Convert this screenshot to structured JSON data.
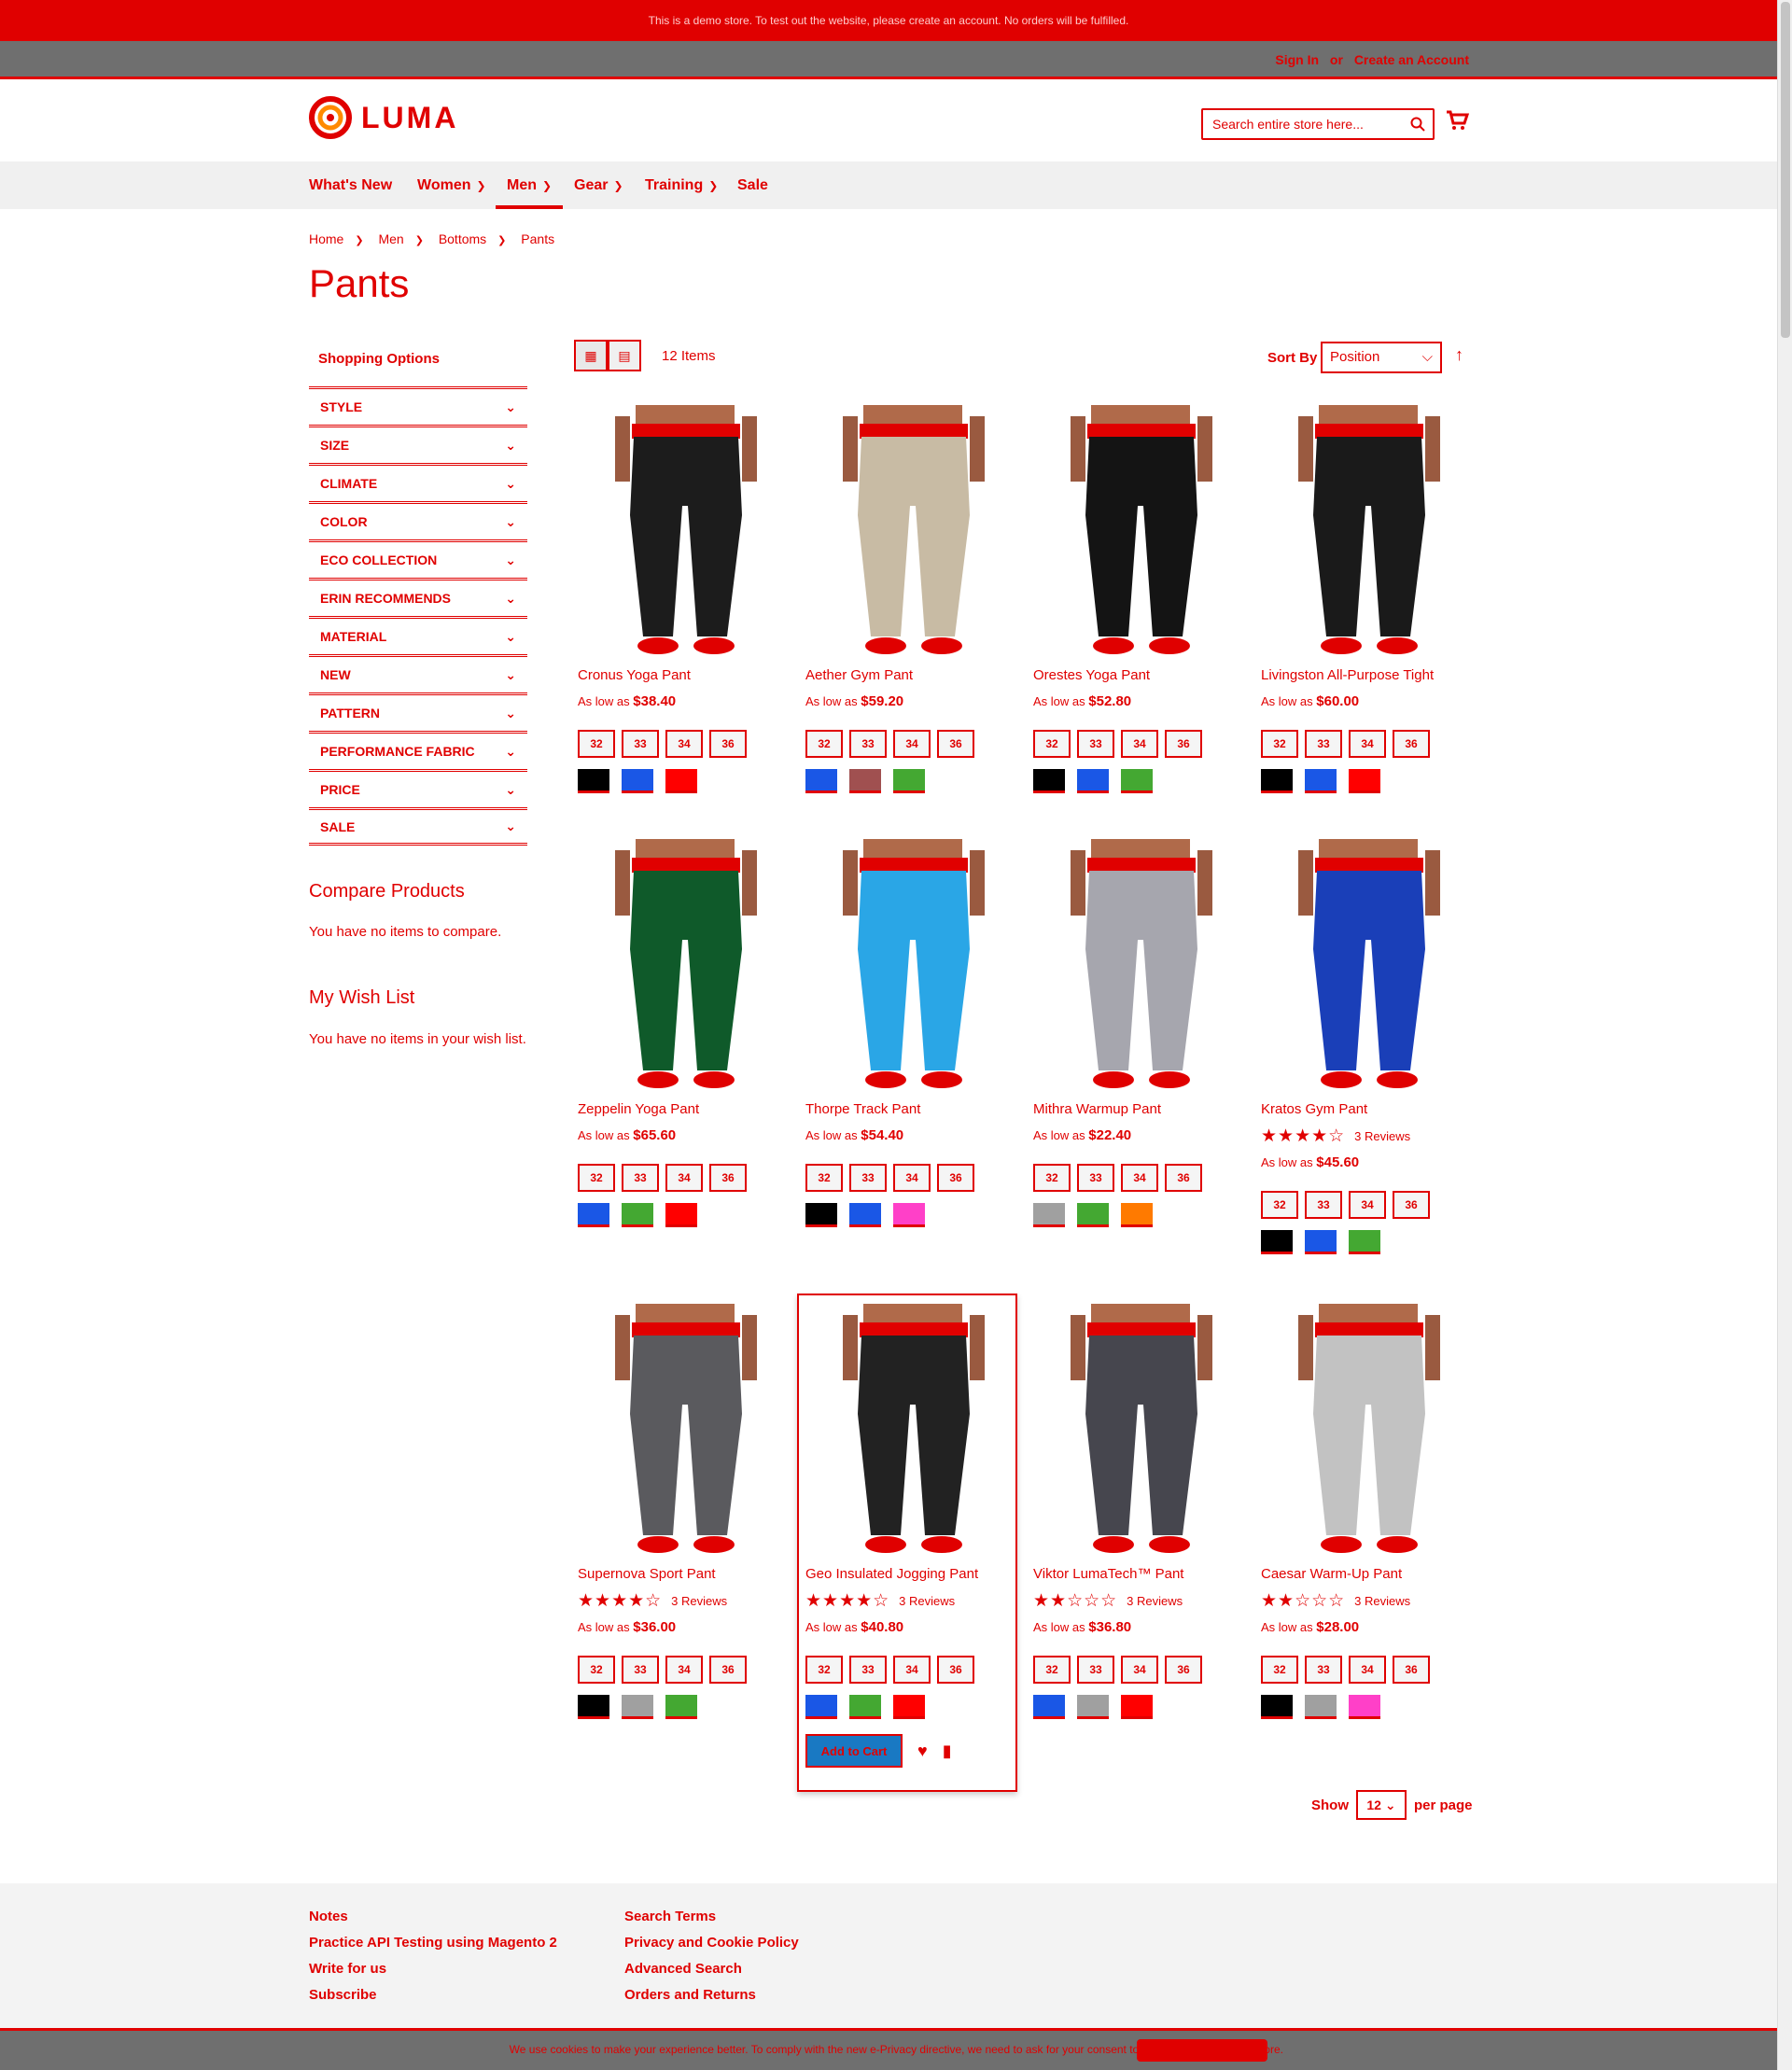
{
  "promo": "This is a demo store. To test out the website, please create an account. No orders will be fulfilled.",
  "header_links": {
    "sign_in": "Sign In",
    "or": "or",
    "create": "Create an Account"
  },
  "logo": "LUMA",
  "search": {
    "placeholder": "Search entire store here..."
  },
  "nav": [
    "What's New",
    "Women",
    "Men",
    "Gear",
    "Training",
    "Sale"
  ],
  "breadcrumb": [
    "Home",
    "Men",
    "Bottoms",
    "Pants"
  ],
  "page_title": "Pants",
  "sidebar": {
    "title": "Shopping Options",
    "filters": [
      "Style",
      "Size",
      "Climate",
      "Color",
      "Eco Collection",
      "Erin Recommends",
      "Material",
      "New",
      "Pattern",
      "Performance Fabric",
      "Price",
      "Sale"
    ],
    "compare_title": "Compare Products",
    "compare_empty": "You have no items to compare.",
    "wish_title": "My Wish List",
    "wish_empty": "You have no items in your wish list."
  },
  "toolbar": {
    "count": "12 Items",
    "sort_label": "Sort By",
    "sort_value": "Position"
  },
  "products": [
    {
      "name": "Cronus Yoga Pant",
      "price_prefix": "As low as",
      "price": "$38.40",
      "sizes": [
        "32",
        "33",
        "34",
        "36"
      ],
      "swatches": [
        "#000000",
        "#1a57e6",
        "#ff0000"
      ],
      "pant": "#1c1c1c"
    },
    {
      "name": "Aether Gym Pant",
      "price_prefix": "As low as",
      "price": "$59.20",
      "sizes": [
        "32",
        "33",
        "34",
        "36"
      ],
      "swatches": [
        "#1a57e6",
        "#a05050",
        "#44a832"
      ],
      "pant": "#c8bba4"
    },
    {
      "name": "Orestes Yoga Pant",
      "price_prefix": "As low as",
      "price": "$52.80",
      "sizes": [
        "32",
        "33",
        "34",
        "36"
      ],
      "swatches": [
        "#000000",
        "#1a57e6",
        "#44a832"
      ],
      "pant": "#141414"
    },
    {
      "name": "Livingston All-Purpose Tight",
      "price_prefix": "As low as",
      "price": "$60.00",
      "sizes": [
        "32",
        "33",
        "34",
        "36"
      ],
      "swatches": [
        "#000000",
        "#1a57e6",
        "#ff0000"
      ],
      "pant": "#1a1a1a"
    },
    {
      "name": "Zeppelin Yoga Pant",
      "price_prefix": "As low as",
      "price": "$65.60",
      "sizes": [
        "32",
        "33",
        "34",
        "36"
      ],
      "swatches": [
        "#1a57e6",
        "#44a832",
        "#ff0000"
      ],
      "pant": "#0f5a2a"
    },
    {
      "name": "Thorpe Track Pant",
      "price_prefix": "As low as",
      "price": "$54.40",
      "sizes": [
        "32",
        "33",
        "34",
        "36"
      ],
      "swatches": [
        "#000000",
        "#1a57e6",
        "#ff40c8"
      ],
      "pant": "#2aa6e6"
    },
    {
      "name": "Mithra Warmup Pant",
      "price_prefix": "As low as",
      "price": "$22.40",
      "sizes": [
        "32",
        "33",
        "34",
        "36"
      ],
      "swatches": [
        "#a0a0a0",
        "#44a832",
        "#ff7a00"
      ],
      "pant": "#a6a6ae"
    },
    {
      "name": "Kratos Gym Pant",
      "rating": "★★★★☆",
      "reviews": "3 Reviews",
      "price_prefix": "As low as",
      "price": "$45.60",
      "sizes": [
        "32",
        "33",
        "34",
        "36"
      ],
      "swatches": [
        "#000000",
        "#1a57e6",
        "#44a832"
      ],
      "pant": "#1a3fb8"
    },
    {
      "name": "Supernova Sport Pant",
      "rating": "★★★★☆",
      "reviews": "3 Reviews",
      "price_prefix": "As low as",
      "price": "$36.00",
      "sizes": [
        "32",
        "33",
        "34",
        "36"
      ],
      "swatches": [
        "#000000",
        "#a0a0a0",
        "#44a832"
      ],
      "pant": "#5a5a5e"
    },
    {
      "name": "Geo Insulated Jogging Pant",
      "rating": "★★★★☆",
      "reviews": "3 Reviews",
      "price_prefix": "As low as",
      "price": "$40.80",
      "sizes": [
        "32",
        "33",
        "34",
        "36"
      ],
      "swatches": [
        "#1a57e6",
        "#44a832",
        "#ff0000"
      ],
      "pant": "#222222",
      "add_to_cart": "Add to Cart"
    },
    {
      "name": "Viktor LumaTech™ Pant",
      "rating": "★★☆☆☆",
      "reviews": "3 Reviews",
      "price_prefix": "As low as",
      "price": "$36.80",
      "sizes": [
        "32",
        "33",
        "34",
        "36"
      ],
      "swatches": [
        "#1a57e6",
        "#a0a0a0",
        "#ff0000"
      ],
      "pant": "#46464e"
    },
    {
      "name": "Caesar Warm-Up Pant",
      "rating": "★★☆☆☆",
      "reviews": "3 Reviews",
      "price_prefix": "As low as",
      "price": "$28.00",
      "sizes": [
        "32",
        "33",
        "34",
        "36"
      ],
      "swatches": [
        "#000000",
        "#a0a0a0",
        "#ff40c8"
      ],
      "pant": "#c2c2c2"
    }
  ],
  "limiter": {
    "show": "Show",
    "value": "12",
    "per_page": "per page"
  },
  "footer": {
    "col1": [
      "Notes",
      "Practice API Testing using Magento 2",
      "Write for us",
      "Subscribe"
    ],
    "col2": [
      "Search Terms",
      "Privacy and Cookie Policy",
      "Advanced Search",
      "Orders and Returns"
    ]
  },
  "cookie": "We use cookies to make your experience better. To comply with the new e-Privacy directive, we need to ask for your consent to set the cookies. Learn more.",
  "colors": {
    "accent": "#e00000",
    "add_to_cart": "#1979c3"
  }
}
